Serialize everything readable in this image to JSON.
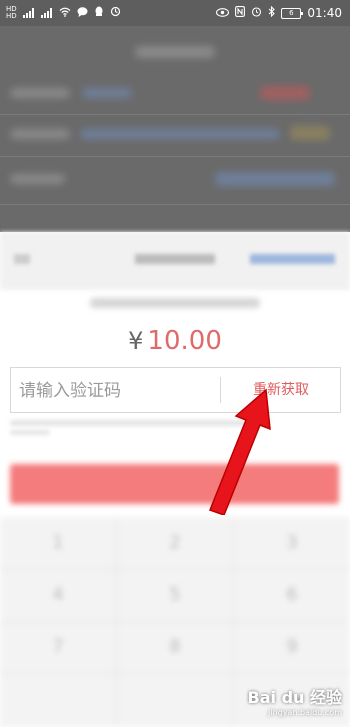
{
  "status_bar": {
    "hd1": "HD",
    "hd2": "HD",
    "battery": "6",
    "time": "01:40"
  },
  "payment": {
    "currency_symbol": "¥",
    "amount": "10.00",
    "code_placeholder": "请输入验证码",
    "resend_label": "重新获取"
  },
  "keypad": {
    "keys": [
      "1",
      "2",
      "3",
      "4",
      "5",
      "6",
      "7",
      "8",
      "9"
    ]
  },
  "watermark": {
    "brand": "Bai du 经验",
    "url": "jingyan.baidu.com"
  },
  "colors": {
    "accent": "#e05b5b",
    "arrow": "#e8141c"
  }
}
